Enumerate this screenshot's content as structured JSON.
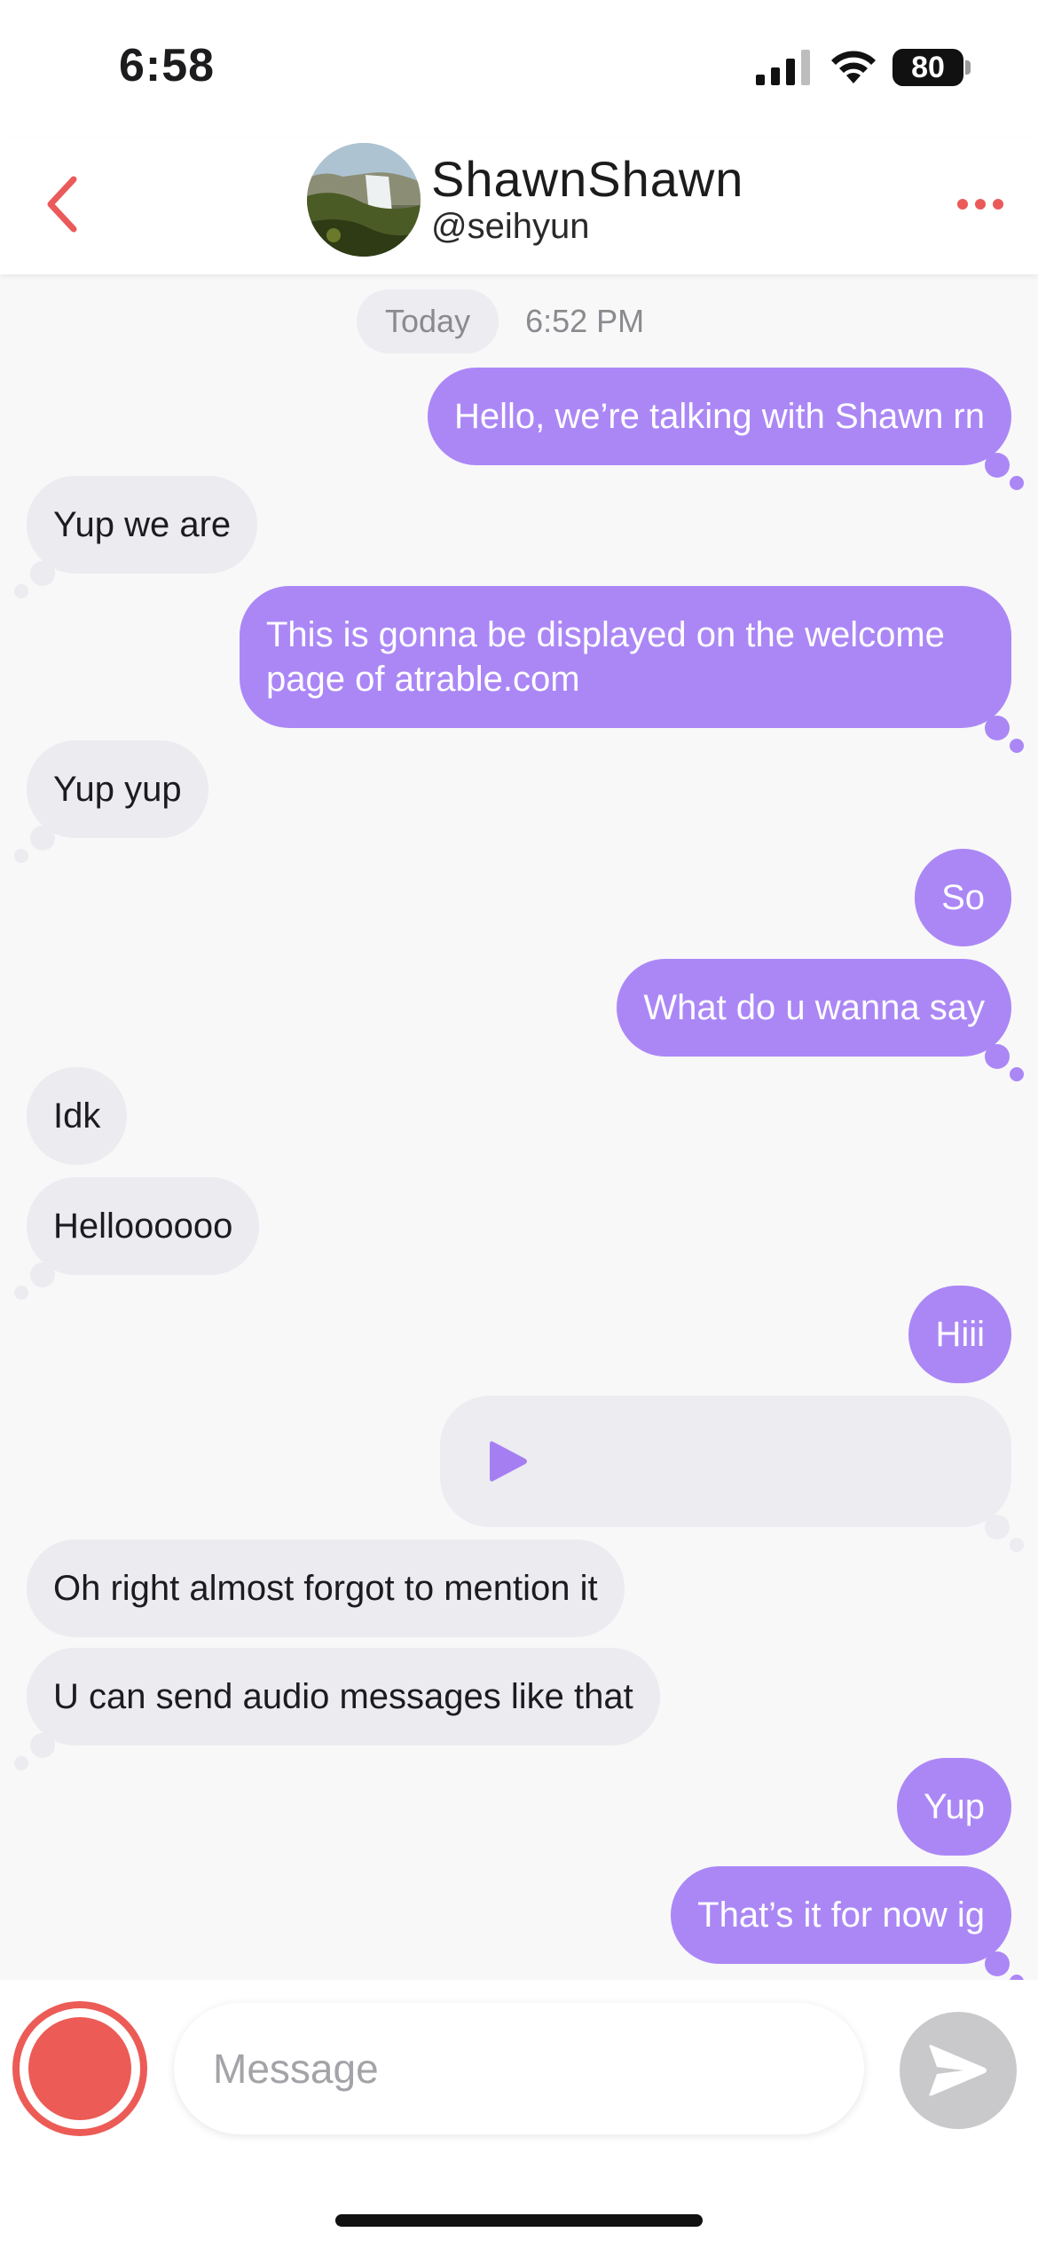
{
  "status_bar": {
    "time": "6:58",
    "battery": "80"
  },
  "header": {
    "display_name": "ShawnShawn",
    "handle": "@seihyun",
    "accent_color": "#ea5a5a"
  },
  "conversation": {
    "date_label": "Today",
    "date_time": "6:52 PM",
    "messages": [
      {
        "direction": "out",
        "text": "Hello, we’re talking with Shawn rn"
      },
      {
        "direction": "in",
        "text": "Yup we are"
      },
      {
        "direction": "out",
        "text": "This is gonna be displayed on the welcome page of atrable.com"
      },
      {
        "direction": "in",
        "text": "Yup yup"
      },
      {
        "direction": "out",
        "text": "So"
      },
      {
        "direction": "out",
        "text": "What do u wanna say"
      },
      {
        "direction": "in",
        "text": "Idk"
      },
      {
        "direction": "in",
        "text": "Helloooooo"
      },
      {
        "direction": "out",
        "text": "Hiii"
      },
      {
        "direction": "out",
        "type": "audio",
        "icon": "play-icon"
      },
      {
        "direction": "in",
        "text": "Oh right almost forgot to mention it"
      },
      {
        "direction": "in",
        "text": "U can send audio messages like that"
      },
      {
        "direction": "out",
        "text": "Yup"
      },
      {
        "direction": "out",
        "text": "That’s it for now ig"
      }
    ],
    "outgoing_color": "#ab87f6",
    "incoming_color": "#ebebf0"
  },
  "composer": {
    "placeholder": "Message",
    "value": "",
    "record_color": "#ec5b56",
    "send_icon": "send-icon"
  }
}
